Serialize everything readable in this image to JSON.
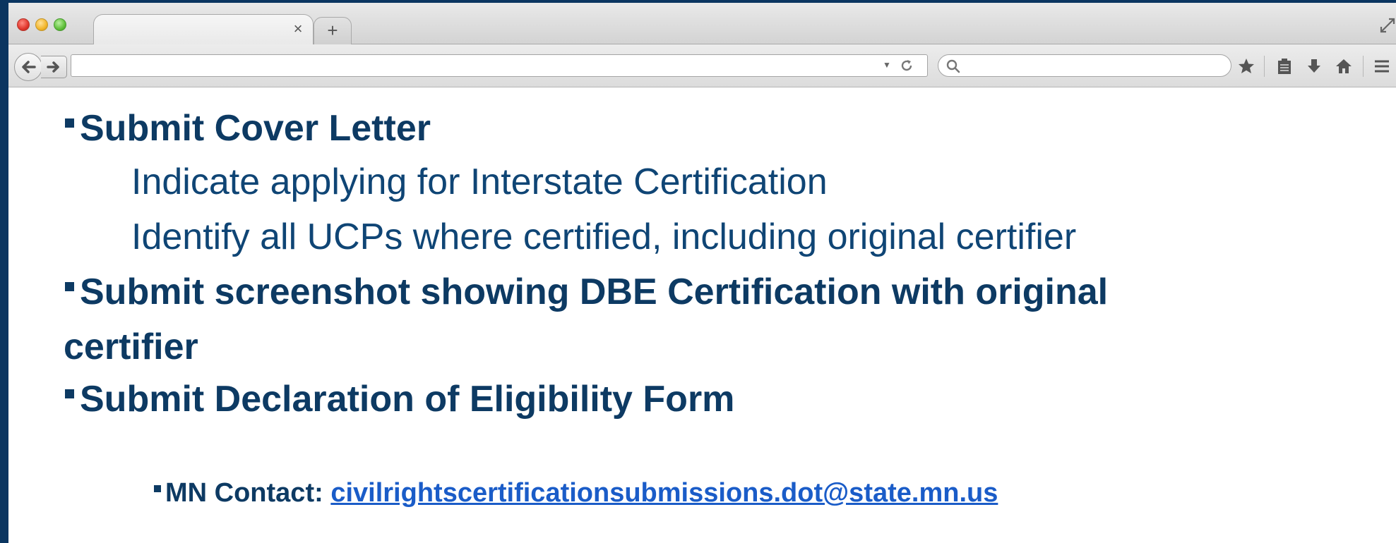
{
  "browser": {
    "tab": {
      "title": "",
      "close_glyph": "×"
    },
    "new_tab_glyph": "+",
    "url": {
      "value": "",
      "placeholder": ""
    },
    "search": {
      "value": "",
      "placeholder": ""
    },
    "icons": [
      "back-arrow-icon",
      "forward-arrow-icon",
      "dropdown-icon",
      "reload-icon",
      "search-icon",
      "bookmark-star-icon",
      "clipboard-icon",
      "download-icon",
      "home-icon",
      "menu-icon",
      "resize-icon"
    ]
  },
  "slide": {
    "items": [
      {
        "text": "Submit Cover Letter"
      },
      {
        "text": "Submit screenshot showing DBE Certification with original"
      },
      {
        "text": "Submit Declaration of Eligibility Form"
      }
    ],
    "item_continuation": "certifier",
    "sub_items": [
      {
        "text": "Indicate applying for Interstate Certification"
      },
      {
        "text": "Identify all UCPs where certified, including original certifier"
      }
    ],
    "contact": {
      "label": "MN Contact:",
      "email": "civilrightscertificationsubmissions.dot@state.mn.us"
    }
  },
  "colors": {
    "frame_background": "#0b3560",
    "text": "#0d3a63",
    "link": "#1a5cc8"
  }
}
